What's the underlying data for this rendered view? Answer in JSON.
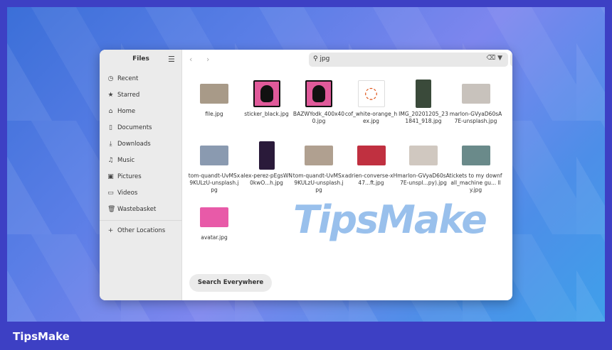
{
  "brand": "TipsMake",
  "watermark": "TipsMake",
  "sidebar": {
    "title": "Files",
    "items": [
      {
        "label": "Recent",
        "icon": "clock-icon",
        "glyph": "◷"
      },
      {
        "label": "Starred",
        "icon": "star-icon",
        "glyph": "★"
      },
      {
        "label": "Home",
        "icon": "home-icon",
        "glyph": "⌂"
      },
      {
        "label": "Documents",
        "icon": "document-icon",
        "glyph": "▯"
      },
      {
        "label": "Downloads",
        "icon": "download-icon",
        "glyph": "⤓"
      },
      {
        "label": "Music",
        "icon": "music-icon",
        "glyph": "♫"
      },
      {
        "label": "Pictures",
        "icon": "picture-icon",
        "glyph": "▣"
      },
      {
        "label": "Videos",
        "icon": "video-icon",
        "glyph": "▭"
      },
      {
        "label": "Wastebasket",
        "icon": "trash-icon",
        "glyph": "🗑"
      }
    ],
    "other": "Other Locations"
  },
  "search": {
    "value": "jpg"
  },
  "files": [
    {
      "name": "file.jpg",
      "thumb": "#a89a88"
    },
    {
      "name": "sticker_black.jpg",
      "thumb": "penguin"
    },
    {
      "name": "BAZWYodk_400x400.jpg",
      "thumb": "penguin"
    },
    {
      "name": "cof_white-orange_hex.jpg",
      "thumb": "ubuntu"
    },
    {
      "name": "IMG_20201205_231841_918.jpg",
      "thumb": "#3a4a3a"
    },
    {
      "name": "marlon-GVyaD60sA7E-unsplash.jpg",
      "thumb": "#c8c2bc"
    },
    {
      "name": "tom-quandt-UvMSx9KULzU-unsplash.jpg",
      "thumb": "#8a9ab0"
    },
    {
      "name": "alex-perez-pEgsWN0kwO...h.jpg",
      "thumb": "#2a1a3a"
    },
    {
      "name": "tom-quandt-UvMSx9KULzU-unsplash.jpg",
      "thumb": "#b0a090"
    },
    {
      "name": "adrien-converse-xH47...ft.jpg",
      "thumb": "#c03040"
    },
    {
      "name": "marlon-GVyaD60sA7E-unspl...py).jpg",
      "thumb": "#d0c8c0"
    },
    {
      "name": "tickets to my downfall_machine gu... lly.jpg",
      "thumb": "#6a8a8a"
    },
    {
      "name": "avatar.jpg",
      "thumb": "#e85aa8"
    }
  ],
  "search_everywhere": "Search Everywhere"
}
